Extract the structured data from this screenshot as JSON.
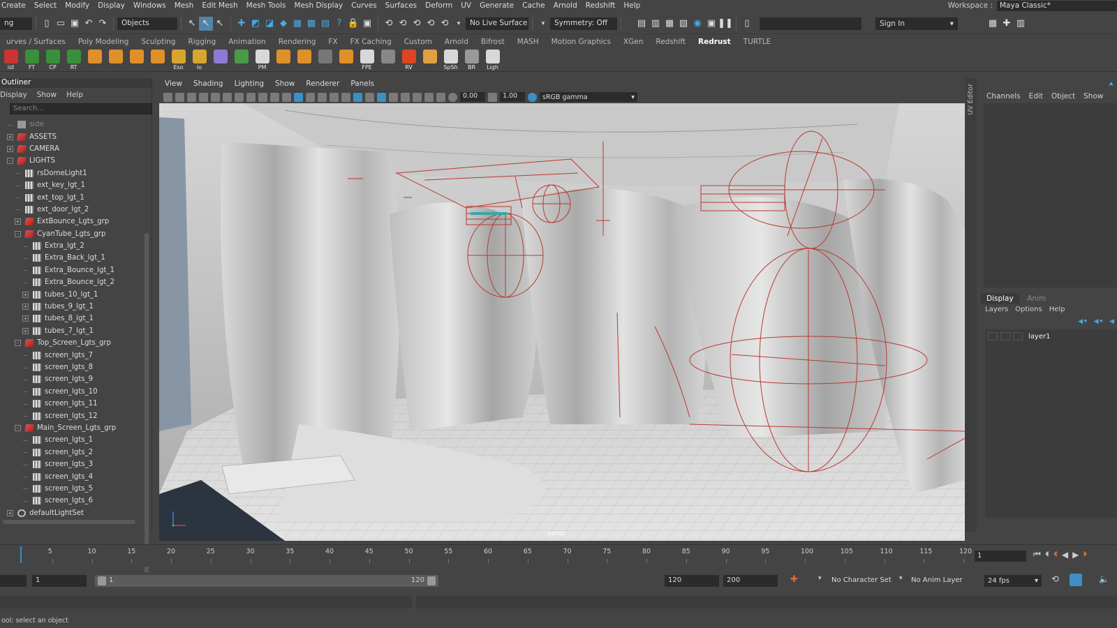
{
  "menubar": {
    "items": [
      "Create",
      "Select",
      "Modify",
      "Display",
      "Windows",
      "Mesh",
      "Edit Mesh",
      "Mesh Tools",
      "Mesh Display",
      "Curves",
      "Surfaces",
      "Deform",
      "UV",
      "Generate",
      "Cache",
      "Arnold",
      "Redshift",
      "Help"
    ],
    "workspace_label": "Workspace :",
    "workspace_value": "Maya Classic*"
  },
  "statusline": {
    "mode_value": "ng",
    "selection_mode": "Objects",
    "live_surface": "No Live Surface",
    "symmetry": "Symmetry: Off",
    "sign_in": "Sign In"
  },
  "shelf": {
    "tabs": [
      "urves / Surfaces",
      "Poly Modeling",
      "Sculpting",
      "Rigging",
      "Animation",
      "Rendering",
      "FX",
      "FX Caching",
      "Custom",
      "Arnold",
      "Bifrost",
      "MASH",
      "Motion Graphics",
      "XGen",
      "Redshift",
      "Redrust",
      "TURTLE"
    ],
    "active_tab": "Redrust",
    "buttons": [
      {
        "label": "ist",
        "color": "#c33"
      },
      {
        "label": "FT",
        "color": "#3a8f3a"
      },
      {
        "label": "CP",
        "color": "#3a8f3a"
      },
      {
        "label": "RT",
        "color": "#3a8f3a"
      },
      {
        "label": "",
        "color": "#e0902a"
      },
      {
        "label": "",
        "color": "#e0902a"
      },
      {
        "label": "",
        "color": "#e0902a"
      },
      {
        "label": "",
        "color": "#e0902a"
      },
      {
        "label": "Eso",
        "color": "#d9a530"
      },
      {
        "label": "Io",
        "color": "#d9a530"
      },
      {
        "label": "",
        "color": "#8c7ad6"
      },
      {
        "label": "",
        "color": "#4a9a4a"
      },
      {
        "label": "PM",
        "color": "#d8d8d8"
      },
      {
        "label": "",
        "color": "#e0902a"
      },
      {
        "label": "",
        "color": "#e0902a"
      },
      {
        "label": "",
        "color": "#777"
      },
      {
        "label": "",
        "color": "#e0902a"
      },
      {
        "label": "FPE",
        "color": "#d8d8d8"
      },
      {
        "label": "",
        "color": "#888"
      },
      {
        "label": "RV",
        "color": "#d42"
      },
      {
        "label": "",
        "color": "#e0a040"
      },
      {
        "label": "SpSh",
        "color": "#d8d8d8"
      },
      {
        "label": "BR",
        "color": "#999"
      },
      {
        "label": "Ligh",
        "color": "#d8d8d8"
      }
    ]
  },
  "outliner": {
    "title": "Outliner",
    "menu": [
      "Display",
      "Show",
      "Help"
    ],
    "search_placeholder": "Search...",
    "items": [
      {
        "label": "side",
        "indent": 0,
        "type": "cam",
        "exp": "",
        "dim": true
      },
      {
        "label": "ASSETS",
        "indent": 0,
        "type": "grp",
        "exp": "+"
      },
      {
        "label": "CAMERA",
        "indent": 0,
        "type": "grp",
        "exp": "+"
      },
      {
        "label": "LIGHTS",
        "indent": 0,
        "type": "grp",
        "exp": "-"
      },
      {
        "label": "rsDomeLight1",
        "indent": 1,
        "type": "lgt",
        "exp": ""
      },
      {
        "label": "ext_key_lgt_1",
        "indent": 1,
        "type": "lgt",
        "exp": ""
      },
      {
        "label": "ext_top_lgt_1",
        "indent": 1,
        "type": "lgt",
        "exp": ""
      },
      {
        "label": "ext_door_lgt_2",
        "indent": 1,
        "type": "lgt",
        "exp": ""
      },
      {
        "label": "ExtBounce_Lgts_grp",
        "indent": 1,
        "type": "grp",
        "exp": "+"
      },
      {
        "label": "CyanTube_Lgts_grp",
        "indent": 1,
        "type": "grp",
        "exp": "-"
      },
      {
        "label": "Extra_lgt_2",
        "indent": 2,
        "type": "lgt",
        "exp": ""
      },
      {
        "label": "Extra_Back_lgt_1",
        "indent": 2,
        "type": "lgt",
        "exp": ""
      },
      {
        "label": "Extra_Bounce_lgt_1",
        "indent": 2,
        "type": "lgt",
        "exp": ""
      },
      {
        "label": "Extra_Bounce_lgt_2",
        "indent": 2,
        "type": "lgt",
        "exp": ""
      },
      {
        "label": "tubes_10_lgt_1",
        "indent": 2,
        "type": "lgt",
        "exp": "+"
      },
      {
        "label": "tubes_9_lgt_1",
        "indent": 2,
        "type": "lgt",
        "exp": "+"
      },
      {
        "label": "tubes_8_lgt_1",
        "indent": 2,
        "type": "lgt",
        "exp": "+"
      },
      {
        "label": "tubes_7_lgt_1",
        "indent": 2,
        "type": "lgt",
        "exp": "+"
      },
      {
        "label": "Top_Screen_Lgts_grp",
        "indent": 1,
        "type": "grp",
        "exp": "-"
      },
      {
        "label": "screen_lgts_7",
        "indent": 2,
        "type": "lgt",
        "exp": ""
      },
      {
        "label": "screen_lgts_8",
        "indent": 2,
        "type": "lgt",
        "exp": ""
      },
      {
        "label": "screen_lgts_9",
        "indent": 2,
        "type": "lgt",
        "exp": ""
      },
      {
        "label": "screen_lgts_10",
        "indent": 2,
        "type": "lgt",
        "exp": ""
      },
      {
        "label": "screen_lgts_11",
        "indent": 2,
        "type": "lgt",
        "exp": ""
      },
      {
        "label": "screen_lgts_12",
        "indent": 2,
        "type": "lgt",
        "exp": ""
      },
      {
        "label": "Main_Screen_Lgts_grp",
        "indent": 1,
        "type": "grp",
        "exp": "-"
      },
      {
        "label": "screen_lgts_1",
        "indent": 2,
        "type": "lgt",
        "exp": ""
      },
      {
        "label": "screen_lgts_2",
        "indent": 2,
        "type": "lgt",
        "exp": ""
      },
      {
        "label": "screen_lgts_3",
        "indent": 2,
        "type": "lgt",
        "exp": ""
      },
      {
        "label": "screen_lgts_4",
        "indent": 2,
        "type": "lgt",
        "exp": ""
      },
      {
        "label": "screen_lgts_5",
        "indent": 2,
        "type": "lgt",
        "exp": ""
      },
      {
        "label": "screen_lgts_6",
        "indent": 2,
        "type": "lgt",
        "exp": ""
      },
      {
        "label": "defaultLightSet",
        "indent": 0,
        "type": "set",
        "exp": "+"
      }
    ]
  },
  "viewport": {
    "menu": [
      "View",
      "Shading",
      "Lighting",
      "Show",
      "Renderer",
      "Panels"
    ],
    "exposure": "0.00",
    "gamma": "1.00",
    "color_space": "sRGB gamma",
    "camera": "persp"
  },
  "channelbox": {
    "side_label": "UV Editor",
    "menu": [
      "Channels",
      "Edit",
      "Object",
      "Show"
    ],
    "layer_tabs": [
      "Display",
      "Anim"
    ],
    "layer_menu": [
      "Layers",
      "Options",
      "Help"
    ],
    "layers": [
      "layer1"
    ]
  },
  "timeline": {
    "ticks": [
      "5",
      "10",
      "15",
      "20",
      "25",
      "30",
      "35",
      "40",
      "45",
      "50",
      "55",
      "60",
      "65",
      "70",
      "75",
      "80",
      "85",
      "90",
      "95",
      "100",
      "105",
      "110",
      "115",
      "120"
    ],
    "current_frame": "1"
  },
  "range": {
    "start": "1",
    "slider_start": "1",
    "slider_end": "120",
    "playback_end": "120",
    "anim_end": "200",
    "character_set": "No Character Set",
    "anim_layer": "No Anim Layer",
    "fps": "24 fps"
  },
  "helpline": {
    "text": "ool: select an object"
  },
  "colors": {
    "panel": "#444444",
    "field": "#2b2b2b",
    "accent": "#3c8fc4",
    "light_wire": "#b83a2c"
  }
}
